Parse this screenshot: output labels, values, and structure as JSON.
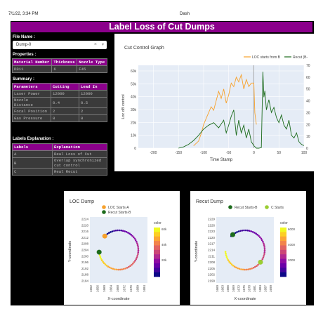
{
  "header": {
    "timestamp": "7/1/22, 3:34 PM",
    "tab_title": "Dash"
  },
  "title": "Label Loss of Cut Dumps",
  "file": {
    "label": "File Name :",
    "value": "Dump-0"
  },
  "properties": {
    "label": "Properties :",
    "headers": [
      "Material Number",
      "Thickness",
      "Nozzle Type"
    ],
    "row": [
      "D011",
      "6",
      "F45"
    ]
  },
  "summary": {
    "label": "Summary :",
    "headers": [
      "Parameters",
      "Cutting",
      "Lead In"
    ],
    "rows": [
      [
        "Laser Power",
        "12000",
        "12000"
      ],
      [
        "Nozzle Distance",
        "0.4",
        "0.5"
      ],
      [
        "Focal Position",
        "2",
        "2"
      ],
      [
        "Gas Pressure",
        "8",
        "8"
      ]
    ]
  },
  "labels": {
    "label": "Labels Explanation :",
    "headers": [
      "Labels",
      "Explanation"
    ],
    "rows": [
      [
        "A",
        "Real Loss of Cut"
      ],
      [
        "B",
        "Overlap synchronized cut control"
      ],
      [
        "C",
        "Real Recut"
      ]
    ]
  },
  "colors": {
    "purple": "#8b008b",
    "orange": "#f7a12c",
    "green": "#1c6b1c",
    "lightgreen": "#9acd32"
  },
  "chart_data": [
    {
      "type": "line",
      "title": "Cut Control Graph",
      "xlabel": "Time Stamp",
      "ylabel": "Loc dB control",
      "xlim": [
        -230,
        100
      ],
      "ylim": [
        0,
        65000
      ],
      "y2lim": [
        0,
        70
      ],
      "xticks": [
        "-200",
        "-150",
        "-100",
        "-50",
        "0",
        "50",
        "100"
      ],
      "yticks": [
        "0",
        "10k",
        "20k",
        "30k",
        "40k",
        "50k",
        "60k"
      ],
      "y2ticks": [
        "0",
        "10",
        "20",
        "30",
        "40",
        "50",
        "60",
        "70"
      ],
      "legend_position": "top-right",
      "series": [
        {
          "name": "LOC starts from B",
          "color": "#f7a12c",
          "axis": "y2",
          "x": [
            -120,
            -115,
            -110,
            -105,
            -100,
            -95,
            -90,
            -85,
            -80,
            -75,
            -70,
            -65,
            -60,
            -55,
            -50,
            -45,
            -40,
            -35,
            -30,
            -25,
            -20,
            -15,
            -10,
            -5,
            0,
            2,
            5
          ],
          "y": [
            2,
            4,
            6,
            12,
            20,
            25,
            30,
            35,
            32,
            40,
            48,
            42,
            50,
            38,
            45,
            55,
            52,
            60,
            56,
            62,
            50,
            58,
            52,
            55,
            55,
            30,
            20
          ]
        },
        {
          "name": "Recut (B-",
          "color": "#1c6b1c",
          "axis": "y",
          "x": [
            -150,
            -140,
            -130,
            -120,
            -110,
            -100,
            -90,
            -80,
            -70,
            -60,
            -55,
            -50,
            -45,
            -40,
            -35,
            -30,
            -25,
            -20,
            -15,
            -10,
            -5,
            0,
            5,
            10,
            15,
            18,
            20,
            22,
            25,
            30,
            35,
            40,
            45,
            50,
            55,
            60,
            65,
            70,
            75,
            80,
            85,
            90,
            95,
            100
          ],
          "y": [
            0,
            1000,
            3000,
            6000,
            10000,
            15000,
            18000,
            20000,
            16000,
            22000,
            12000,
            18000,
            25000,
            30000,
            10000,
            22000,
            12000,
            18000,
            8000,
            15000,
            5000,
            2000,
            0,
            0,
            500,
            60000,
            40000,
            45000,
            30000,
            38000,
            28000,
            32000,
            24000,
            20000,
            26000,
            18000,
            15000,
            22000,
            10000,
            8000,
            12000,
            5000,
            3000,
            2000
          ]
        }
      ]
    },
    {
      "type": "scatter",
      "title": "LOC Dump",
      "xlabel": "X-coordinate",
      "ylabel": "Y-coordinate",
      "yticks": [
        "2224",
        "2220",
        "2216",
        "2212",
        "2208",
        "2204",
        "2200",
        "2196",
        "2192",
        "2188",
        "2184"
      ],
      "xticks": [
        "1652",
        "1656",
        "1660",
        "1664",
        "1668",
        "1672",
        "1676",
        "1680",
        "1684"
      ],
      "colorbar_title": "color",
      "colorbar_ticks": [
        "60k",
        "40k",
        "20k"
      ],
      "series": [
        {
          "name": "LOC Starts-A",
          "color": "#f7a12c"
        },
        {
          "name": "Recut Starts-B",
          "color": "#1c6b1c"
        }
      ]
    },
    {
      "type": "scatter",
      "title": "Recut Dump",
      "xlabel": "X-coordinate",
      "ylabel": "Y-coordinate",
      "yticks": [
        "2229",
        "2226",
        "2223",
        "2220",
        "2217",
        "2214",
        "2211",
        "2208",
        "2205",
        "2202",
        "2199"
      ],
      "xticks": [
        "1660",
        "1663",
        "1666",
        "1669",
        "1672",
        "1675",
        "1678",
        "1681",
        "1684",
        "1687",
        "1690"
      ],
      "colorbar_title": "color",
      "colorbar_ticks": [
        "6000",
        "4000",
        "2000"
      ],
      "series": [
        {
          "name": "Recut Starts-B",
          "color": "#1c6b1c"
        },
        {
          "name": "C Starts",
          "color": "#9acd32"
        }
      ]
    }
  ]
}
